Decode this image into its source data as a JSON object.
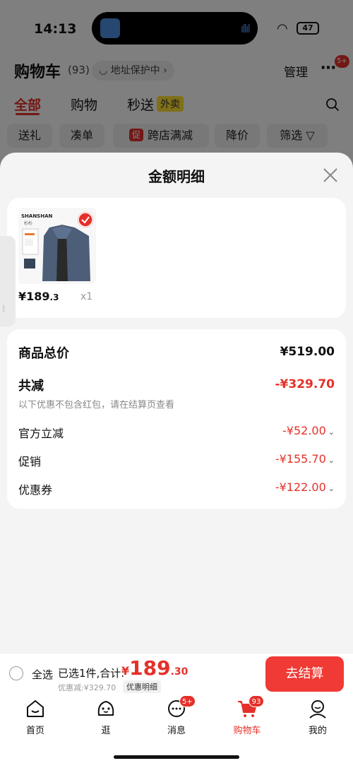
{
  "status_bar": {
    "time": "14:13",
    "battery": "47"
  },
  "header": {
    "title": "购物车",
    "count": "(93)",
    "address_protect": "地址保护中",
    "manage": "管理",
    "more_badge": "5+"
  },
  "tabs": [
    {
      "label": "全部"
    },
    {
      "label": "购物"
    },
    {
      "label": "秒送"
    }
  ],
  "tab_badge": "外卖",
  "filters": {
    "gift": "送礼",
    "bundle": "凑单",
    "cross_store_tag": "促",
    "cross_store": "跨店满减",
    "price_drop": "降价",
    "filter": "筛选"
  },
  "sheet": {
    "title": "金额明细",
    "product": {
      "brand": "SHANSHAN",
      "brand_sub": "杉杉",
      "price_main": "¥189",
      "price_dec": ".3",
      "qty": "x1"
    },
    "summary": {
      "total_label": "商品总价",
      "total_value": "¥519.00",
      "reduce_label": "共减",
      "reduce_value": "-¥329.70",
      "note": "以下优惠不包含红包，请在结算页查看",
      "official_label": "官方立减",
      "official_value": "-¥52.00",
      "promo_label": "促销",
      "promo_value": "-¥155.70",
      "coupon_label": "优惠券",
      "coupon_value": "-¥122.00"
    }
  },
  "checkout": {
    "select_all": "全选",
    "selected": "已选1件,合计:",
    "currency": "¥",
    "total_int": "189",
    "total_dec": ".30",
    "discount": "优惠减:¥329.70",
    "detail": "优惠明细",
    "button": "去结算"
  },
  "nav": {
    "home": "首页",
    "browse": "逛",
    "messages": "消息",
    "messages_badge": "5+",
    "cart": "购物车",
    "cart_badge": "93",
    "mine": "我的"
  },
  "colors": {
    "accent": "#e4312a",
    "button": "#f03a35"
  }
}
